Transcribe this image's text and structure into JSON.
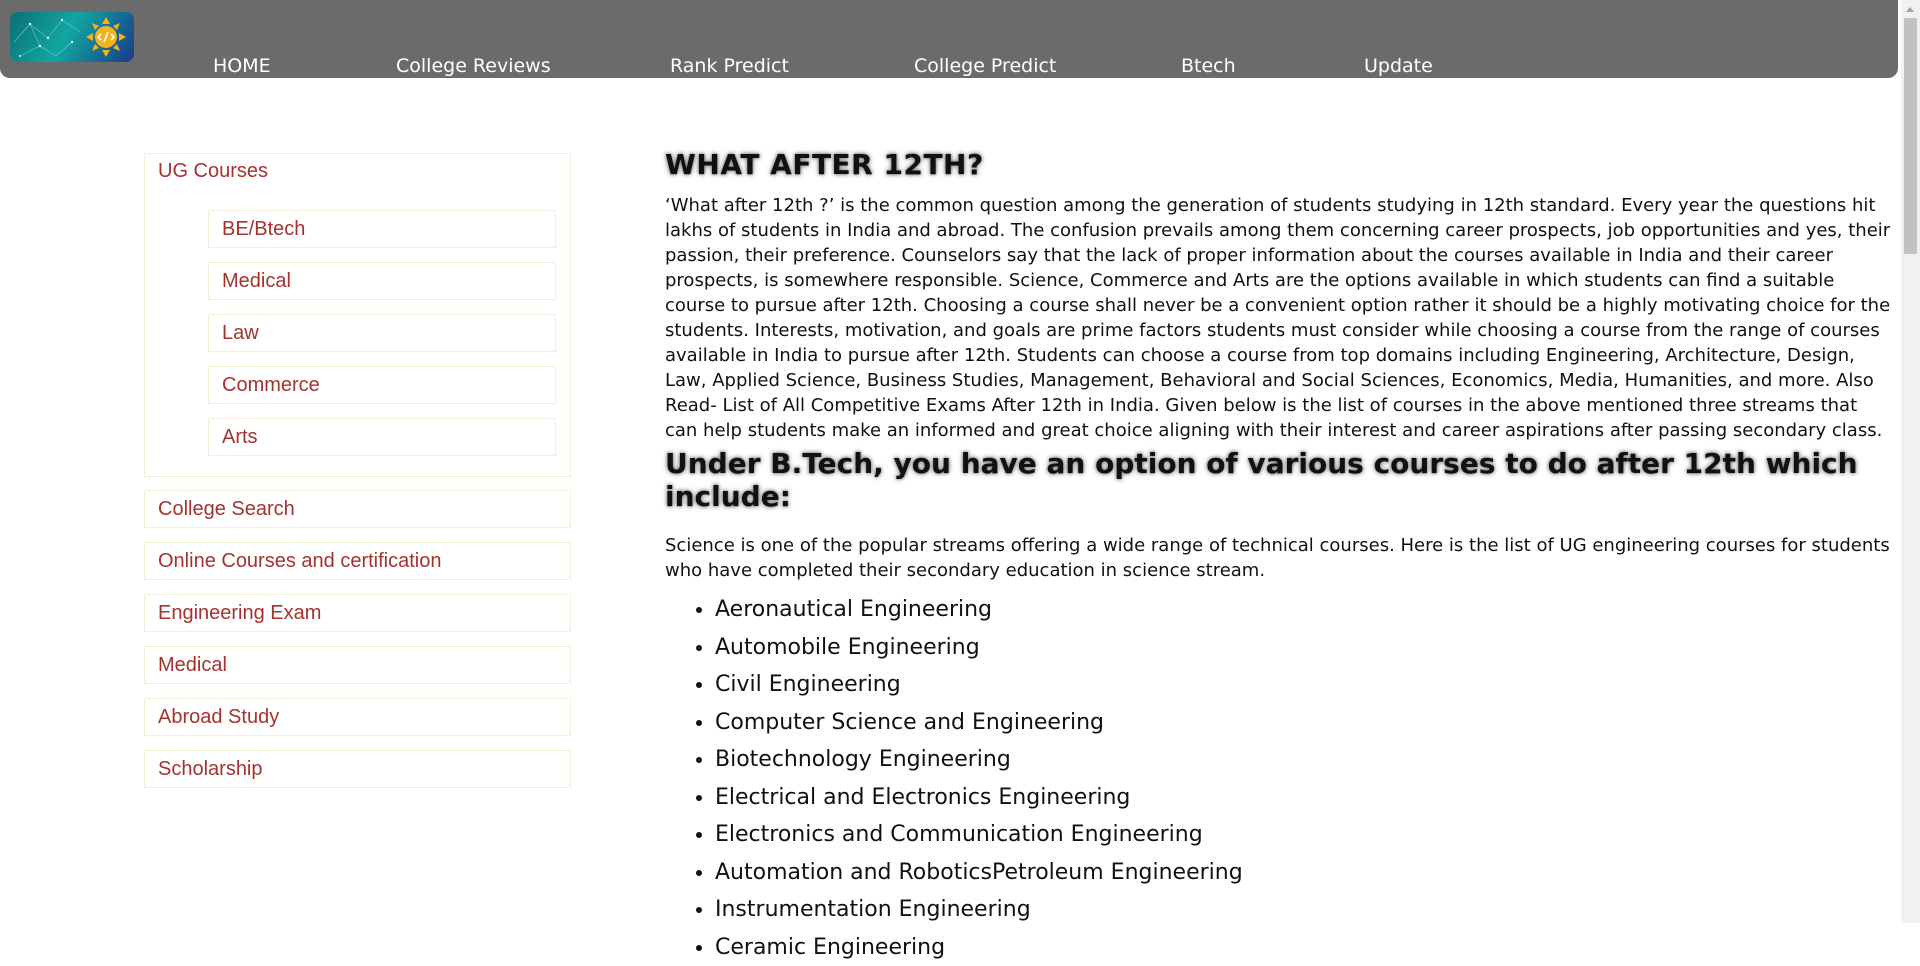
{
  "nav": {
    "items": [
      "HOME",
      "College Reviews",
      "Rank Predict",
      "College Predict",
      "Btech",
      "Update"
    ]
  },
  "sidebar": {
    "group_title": "UG Courses",
    "sub_items": [
      "BE/Btech",
      "Medical",
      "Law",
      "Commerce",
      "Arts"
    ],
    "items": [
      "College Search",
      "Online Courses and certification",
      "Engineering Exam",
      "Medical",
      "Abroad Study",
      "Scholarship"
    ]
  },
  "main": {
    "title": "WHAT AFTER 12TH?",
    "intro": "‘What after 12th ?’ is the common question among the generation of students studying in 12th standard. Every year the questions hit lakhs of students in India and abroad. The confusion prevails among them concerning career prospects, job opportunities and yes, their passion, their preference. Counselors say that the lack of proper information about the courses available in India and their career prospects, is somewhere responsible. Science, Commerce and Arts are the options available in which students can find a suitable course to pursue after 12th. Choosing a course shall never be a convenient option rather it should be a highly motivating choice for the students. Interests, motivation, and goals are prime factors students must consider while choosing a course from the range of courses available in India to pursue after 12th. Students can choose a course from top domains including Engineering, Architecture, Design, Law, Applied Science, Business Studies, Management, Behavioral and Social Sciences, Economics, Media, Humanities, and more. Also Read- List of All Competitive Exams After 12th in India. Given below is the list of courses in the above mentioned three streams that can help students make an informed and great choice aligning with their interest and career aspirations after passing secondary class.",
    "subheading": "Under B.Tech, you have an option of various courses to do after 12th which include:",
    "science_text": "Science is one of the popular streams offering a wide range of technical courses. Here is the list of UG engineering courses for students who have completed their secondary education in science stream.",
    "courses": [
      "Aeronautical Engineering",
      "Automobile Engineering",
      "Civil Engineering",
      "Computer Science and Engineering",
      "Biotechnology Engineering",
      "Electrical and Electronics Engineering",
      "Electronics and Communication Engineering",
      "Automation and RoboticsPetroleum Engineering",
      "Instrumentation Engineering",
      "Ceramic Engineering"
    ]
  },
  "colors": {
    "nav_bg": "#6b6b6b",
    "link": "#a5322e",
    "box_border": "#f3eed8"
  },
  "icons": {
    "logo": "code-sun-logo-icon"
  }
}
